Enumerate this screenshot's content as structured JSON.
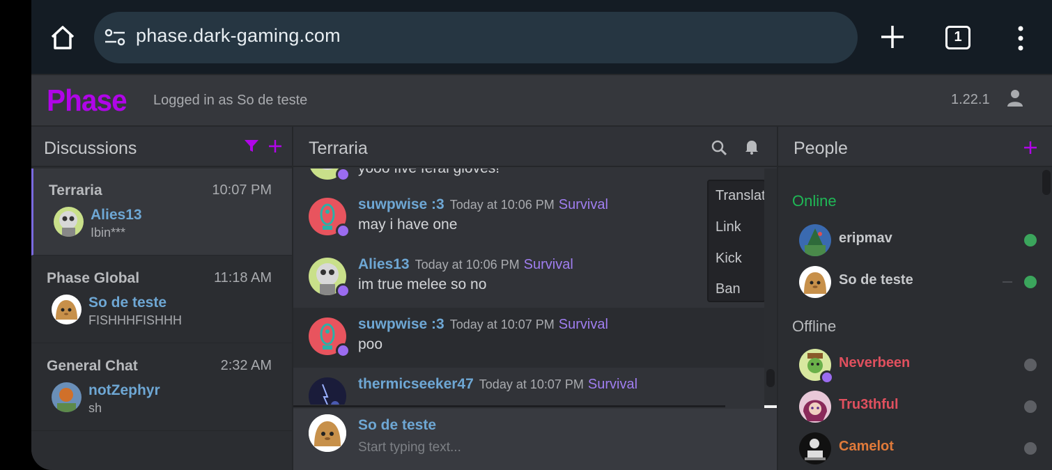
{
  "browser": {
    "url": "phase.dark-gaming.com",
    "tab_count": "1",
    "icons": [
      "home-icon",
      "site-settings-icon",
      "plus-icon",
      "tabs-icon",
      "more-vert-icon"
    ]
  },
  "app": {
    "logo": "Phase",
    "logged_in": "Logged in as So de teste",
    "version": "1.22.1",
    "accent": "#b005e8"
  },
  "discussions": {
    "title": "Discussions",
    "items": [
      {
        "name": "Terraria",
        "time": "10:07 PM",
        "user": "Alies13",
        "message": "Ibin***",
        "active": true
      },
      {
        "name": "Phase Global",
        "time": "11:18 AM",
        "user": "So de teste",
        "message": "FISHHHFISHHH"
      },
      {
        "name": "General Chat",
        "time": "2:32 AM",
        "user": "notZephyr",
        "message": "sh"
      }
    ]
  },
  "chat": {
    "title": "Terraria",
    "partial_message": "yooo five feral gloves!",
    "messages": [
      {
        "user": "suwpwise :3",
        "time": "Today at 10:06 PM",
        "tag": "Survival",
        "text": "may i have one"
      },
      {
        "user": "Alies13",
        "time": "Today at 10:06 PM",
        "tag": "Survival",
        "text": "im true melee so no"
      },
      {
        "user": "suwpwise :3",
        "time": "Today at 10:07 PM",
        "tag": "Survival",
        "text": "poo"
      },
      {
        "user": "thermicseeker47",
        "time": "Today at 10:07 PM",
        "tag": "Survival",
        "text": ""
      }
    ],
    "context_menu": [
      "Translate",
      "Link",
      "Kick",
      "Ban"
    ],
    "composer": {
      "user": "So de teste",
      "placeholder": "Start typing text..."
    }
  },
  "people": {
    "title": "People",
    "online_label": "Online",
    "offline_label": "Offline",
    "online": [
      {
        "name": "eripmav",
        "color": "#c7c9cc",
        "status_color": "#3ba55c"
      },
      {
        "name": "So de teste",
        "color": "#c7c9cc",
        "status_color": "#3ba55c"
      }
    ],
    "offline": [
      {
        "name": "Neverbeen",
        "color": "#e0505e",
        "status_color": "#5d5f64"
      },
      {
        "name": "Tru3thful",
        "color": "#e0505e",
        "status_color": "#5d5f64"
      },
      {
        "name": "Camelot",
        "color": "#e07a3a",
        "status_color": "#5d5f64"
      }
    ]
  }
}
